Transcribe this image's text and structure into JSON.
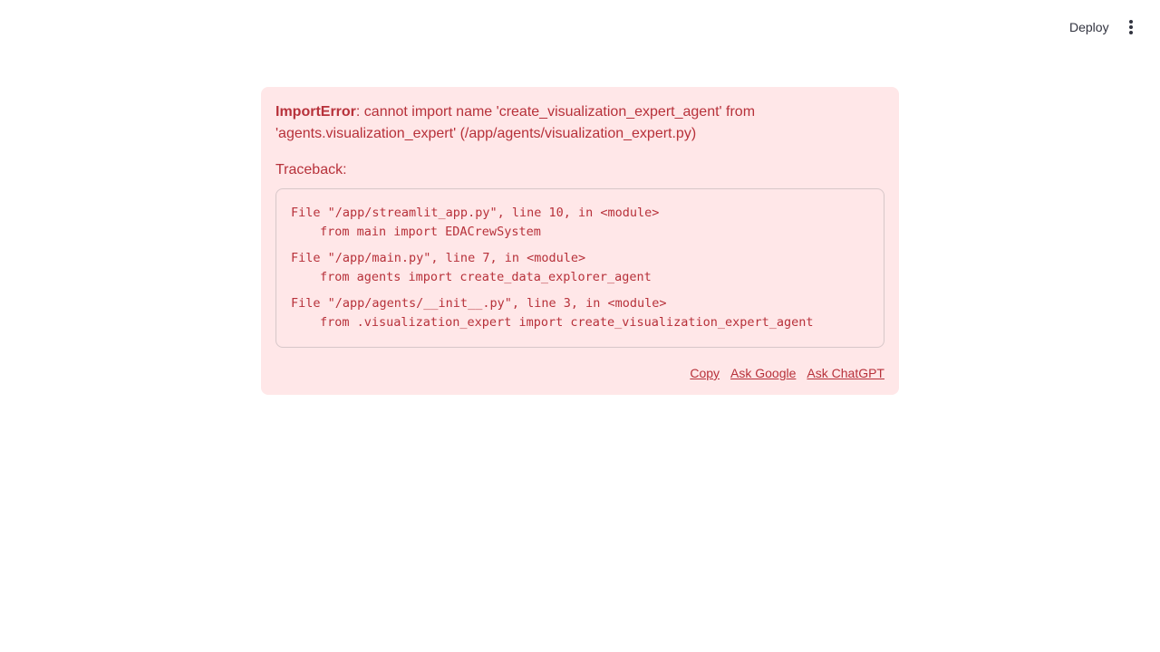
{
  "header": {
    "deploy_label": "Deploy",
    "menu_icon": "kebab-menu-icon"
  },
  "error": {
    "type": "ImportError",
    "message_line1": ": cannot import name 'create_visualization_expert_agent' from",
    "message_line2": "'agents.visualization_expert' (/app/agents/visualization_expert.py)",
    "traceback_label": "Traceback:",
    "frames": [
      {
        "location": "File \"/app/streamlit_app.py\", line 10, in <module>",
        "code": "from main import EDACrewSystem"
      },
      {
        "location": "File \"/app/main.py\", line 7, in <module>",
        "code": "from agents import create_data_explorer_agent"
      },
      {
        "location": "File \"/app/agents/__init__.py\", line 3, in <module>",
        "code": "from .visualization_expert import create_visualization_expert_agent"
      }
    ],
    "actions": {
      "copy": "Copy",
      "ask_google": "Ask Google",
      "ask_chatgpt": "Ask ChatGPT"
    }
  },
  "colors": {
    "error_bg": "#ffe7e8",
    "error_text": "#b7313a",
    "header_text": "#31333f"
  }
}
